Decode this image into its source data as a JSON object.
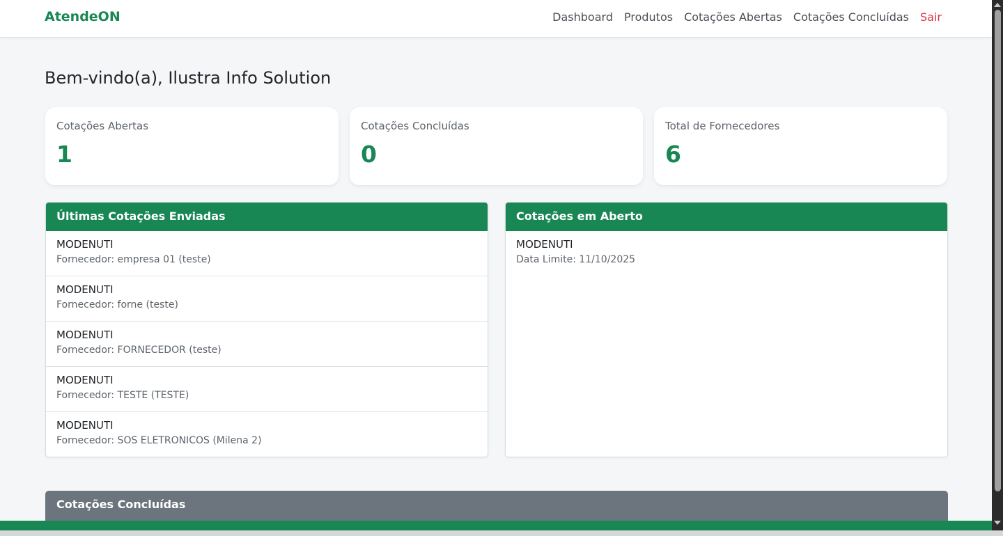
{
  "navbar": {
    "brand": "AtendeON",
    "links": [
      "Dashboard",
      "Produtos",
      "Cotações Abertas",
      "Cotações Concluídas"
    ],
    "logout": "Sair"
  },
  "welcome": "Bem-vindo(a), Ilustra Info Solution",
  "stats": [
    {
      "label": "Cotações Abertas",
      "value": "1"
    },
    {
      "label": "Cotações Concluídas",
      "value": "0"
    },
    {
      "label": "Total de Fornecedores",
      "value": "6"
    }
  ],
  "ultimas": {
    "title": "Últimas Cotações Enviadas",
    "items": [
      {
        "title": "MODENUTI",
        "sub": "Fornecedor: empresa 01 (teste)"
      },
      {
        "title": "MODENUTI",
        "sub": "Fornecedor: forne (teste)"
      },
      {
        "title": "MODENUTI",
        "sub": "Fornecedor: FORNECEDOR (teste)"
      },
      {
        "title": "MODENUTI",
        "sub": "Fornecedor: TESTE (TESTE)"
      },
      {
        "title": "MODENUTI",
        "sub": "Fornecedor: SOS ELETRONICOS (Milena 2)"
      }
    ]
  },
  "aberto": {
    "title": "Cotações em Aberto",
    "items": [
      {
        "title": "MODENUTI",
        "sub": "Data Limite: 11/10/2025"
      }
    ]
  },
  "concluidas": {
    "title": "Cotações Concluídas"
  },
  "colors": {
    "primary": "#198754",
    "secondary": "#6c757d",
    "danger": "#dc3545",
    "background": "#f4f6f8"
  }
}
